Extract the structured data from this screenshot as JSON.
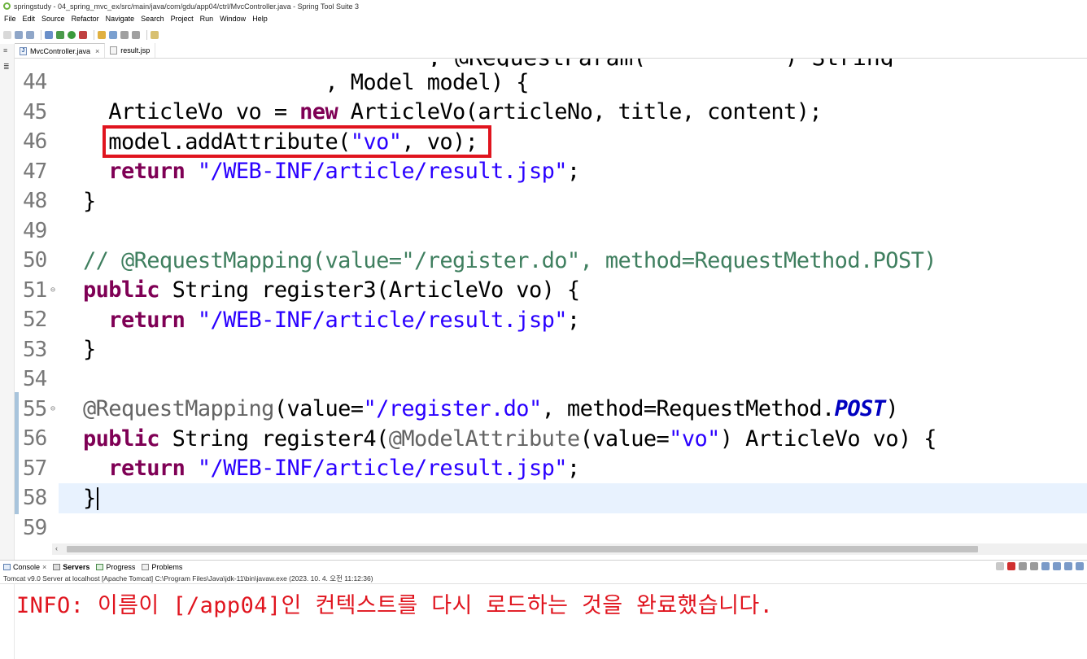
{
  "window": {
    "title": "springstudy - 04_spring_mvc_ex/src/main/java/com/gdu/app04/ctrl/MvcController.java - Spring Tool Suite 3"
  },
  "menu": {
    "items": [
      "File",
      "Edit",
      "Source",
      "Refactor",
      "Navigate",
      "Search",
      "Project",
      "Run",
      "Window",
      "Help"
    ]
  },
  "toolbar": {
    "icons": [
      "new-icon",
      "save-icon",
      "save-all-icon",
      "print-icon",
      "debug-icon",
      "run-icon",
      "external-tools-icon",
      "search-icon",
      "open-type-icon",
      "back-icon",
      "forward-icon",
      "perspective-icon"
    ]
  },
  "editor": {
    "tabs": [
      {
        "label": "MvcController.java",
        "active": true,
        "icon": "java-file-icon"
      },
      {
        "label": "result.jsp",
        "active": false,
        "icon": "jsp-file-icon"
      }
    ],
    "partial_top_line": "    , @RequestParam(          ) String",
    "lines": [
      {
        "no": "44",
        "marker": ""
      },
      {
        "no": "45",
        "marker": ""
      },
      {
        "no": "46",
        "marker": ""
      },
      {
        "no": "47",
        "marker": ""
      },
      {
        "no": "48",
        "marker": ""
      },
      {
        "no": "49",
        "marker": ""
      },
      {
        "no": "50",
        "marker": ""
      },
      {
        "no": "51",
        "marker": "⊖"
      },
      {
        "no": "52",
        "marker": ""
      },
      {
        "no": "53",
        "marker": ""
      },
      {
        "no": "54",
        "marker": ""
      },
      {
        "no": "55",
        "marker": "⊖"
      },
      {
        "no": "56",
        "marker": ""
      },
      {
        "no": "57",
        "marker": ""
      },
      {
        "no": "58",
        "marker": ""
      },
      {
        "no": "59",
        "marker": ""
      }
    ],
    "code": {
      "l44": "                   , Model model) {",
      "l45_a": "  ArticleVo vo = ",
      "l45_kw": "new",
      "l45_b": " ArticleVo(articleNo, title, content);",
      "l46_a": "  model.addAttribute(",
      "l46_str": "\"vo\"",
      "l46_b": ", vo);",
      "l47_kw": "  return",
      "l47_str": " \"/WEB-INF/article/result.jsp\"",
      "l47_b": ";",
      "l48": "}",
      "l50": "// @RequestMapping(value=\"/register.do\", method=RequestMethod.POST)",
      "l51_kw": "public",
      "l51_b": " String register3(ArticleVo vo) {",
      "l52_kw": "  return",
      "l52_str": " \"/WEB-INF/article/result.jsp\"",
      "l52_b": ";",
      "l53": "}",
      "l55_ann": "@RequestMapping",
      "l55_a": "(value=",
      "l55_str": "\"/register.do\"",
      "l55_b": ", method=RequestMethod.",
      "l55_post": "POST",
      "l55_c": ")",
      "l56_kw": "public",
      "l56_a": " String register4(",
      "l56_ann": "@ModelAttribute",
      "l56_b": "(value=",
      "l56_str": "\"vo\"",
      "l56_c": ") ArticleVo vo) {",
      "l57_kw": "  return",
      "l57_str": " \"/WEB-INF/article/result.jsp\"",
      "l57_b": ";",
      "l58": "}"
    }
  },
  "console": {
    "tabs": [
      {
        "label": "Console",
        "closable": true,
        "bold": false
      },
      {
        "label": "Servers",
        "closable": false,
        "bold": true
      },
      {
        "label": "Progress",
        "closable": false,
        "bold": false
      },
      {
        "label": "Problems",
        "closable": false,
        "bold": false
      }
    ],
    "description": "Tomcat v9.0 Server at localhost [Apache Tomcat] C:\\Program Files\\Java\\jdk-11\\bin\\javaw.exe  (2023. 10. 4. 오전 11:12:36)",
    "output_line": "INFO: 이름이 [/app04]인 컨텍스트를 다시 로드하는 것을 완료했습니다."
  },
  "colors": {
    "keyword": "#7f0055",
    "string": "#2a00ff",
    "comment": "#3f7f5f",
    "annotation": "#646464",
    "highlight_box": "#e0141e",
    "current_line": "#e8f2fe",
    "console_text": "#e0141e"
  }
}
